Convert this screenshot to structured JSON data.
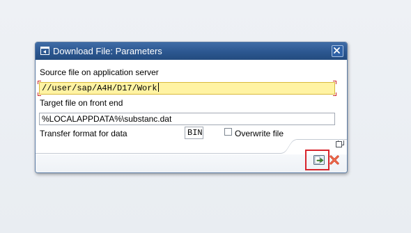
{
  "dialog": {
    "title": "Download File: Parameters",
    "title_icon": "dialog-window-icon",
    "close_icon": "close-icon"
  },
  "fields": {
    "source_label": "Source file on application server",
    "source_value": "//user/sap/A4H/D17/Work",
    "target_label": "Target file on front end",
    "target_value": "%LOCALAPPDATA%\\substanc.dat",
    "target_help_icon": "value-help-icon",
    "format_label": "Transfer format for data",
    "format_value": "BIN",
    "overwrite_label": "Overwrite file",
    "overwrite_checked": false
  },
  "buttons": {
    "continue_icon": "continue-icon",
    "cancel_icon": "cancel-icon"
  },
  "colors": {
    "titlebar": "#2c5790",
    "focused_field": "#fff3a3",
    "highlight": "#d8242c",
    "cancel": "#d9482c",
    "continue": "#3e8a2e"
  }
}
